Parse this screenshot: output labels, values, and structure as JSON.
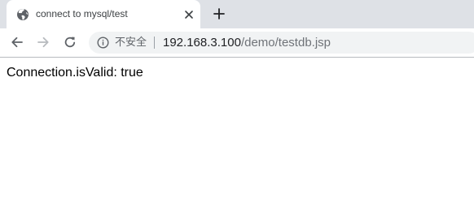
{
  "tab": {
    "title": "connect to mysql/test",
    "favicon": "globe-icon",
    "close_icon": "close-icon"
  },
  "tabstrip": {
    "new_tab_icon": "plus-icon"
  },
  "toolbar": {
    "back_icon": "arrow-left-icon",
    "forward_icon": "arrow-right-icon",
    "reload_icon": "reload-icon"
  },
  "omnibox": {
    "info_icon": "info-icon",
    "security_label": "不安全",
    "url_host": "192.168.3.100",
    "url_path": "/demo/testdb.jsp"
  },
  "page": {
    "text": "Connection.isValid: true"
  },
  "colors": {
    "tabstrip_bg": "#dee1e6",
    "omnibox_bg": "#f1f3f4",
    "url_path": "#6f7378"
  }
}
